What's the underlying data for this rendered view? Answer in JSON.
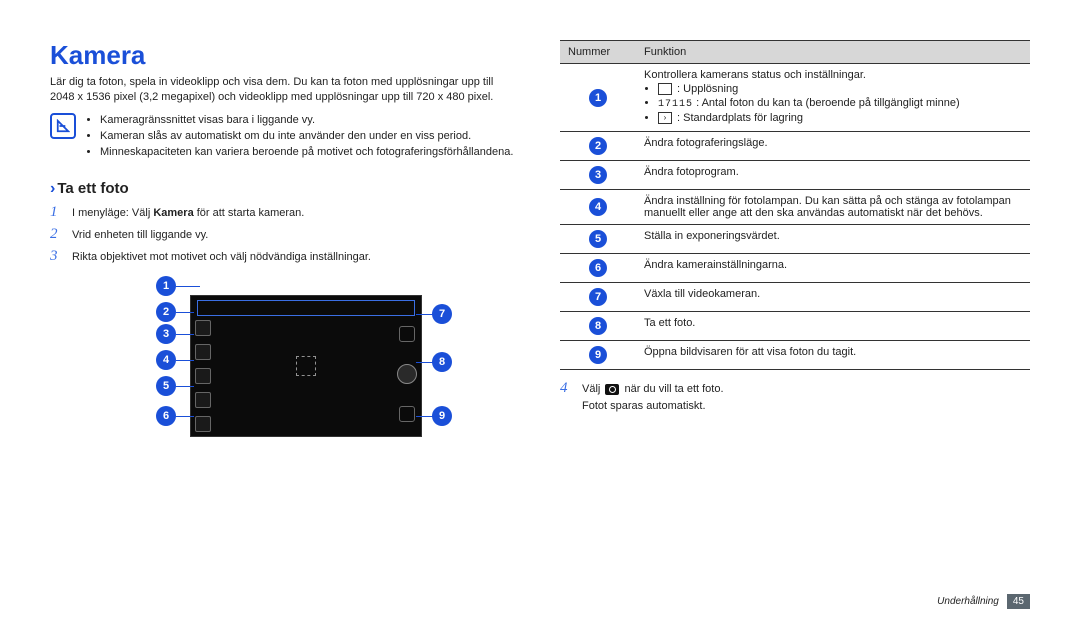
{
  "title": "Kamera",
  "intro": "Lär dig ta foton, spela in videoklipp och visa dem. Du kan ta foton med upplösningar upp till 2048 x 1536 pixel (3,2 megapixel) och videoklipp med upplösningar upp till 720 x 480 pixel.",
  "notes": {
    "items": [
      "Kameragränssnittet visas bara i liggande vy.",
      "Kameran slås av automatiskt om du inte använder den under en viss period.",
      "Minneskapaciteten kan variera beroende på motivet och fotograferingsförhållandena."
    ]
  },
  "subhead": "Ta ett foto",
  "steps": {
    "s1_pre": "I menyläge: Välj ",
    "s1_bold": "Kamera",
    "s1_post": " för att starta kameran.",
    "s2": "Vrid enheten till liggande vy.",
    "s3": "Rikta objektivet mot motivet och välj nödvändiga inställningar.",
    "s4_pre": "Välj ",
    "s4_post": " när du vill ta ett foto.",
    "s4_note": "Fotot sparas automatiskt."
  },
  "table": {
    "head_num": "Nummer",
    "head_func": "Funktion",
    "row1_lead": "Kontrollera kamerans status och inställningar.",
    "row1_b1_post": " : Upplösning",
    "row1_b2_count": "17115",
    "row1_b2_post": " : Antal foton du kan ta (beroende på tillgängligt minne)",
    "row1_b3_post": " : Standardplats för lagring",
    "row2": "Ändra fotograferingsläge.",
    "row3": "Ändra fotoprogram.",
    "row4": "Ändra inställning för fotolampan. Du kan sätta på och stänga av fotolampan manuellt eller ange att den ska användas automatiskt när det behövs.",
    "row5": "Ställa in exponeringsvärdet.",
    "row6": "Ändra kamerainställningarna.",
    "row7": "Växla till videokameran.",
    "row8": "Ta ett foto.",
    "row9": "Öppna bildvisaren för att visa foton du tagit."
  },
  "footer": {
    "section": "Underhållning",
    "page": "45"
  },
  "callouts": {
    "n1": "1",
    "n2": "2",
    "n3": "3",
    "n4": "4",
    "n5": "5",
    "n6": "6",
    "n7": "7",
    "n8": "8",
    "n9": "9"
  }
}
